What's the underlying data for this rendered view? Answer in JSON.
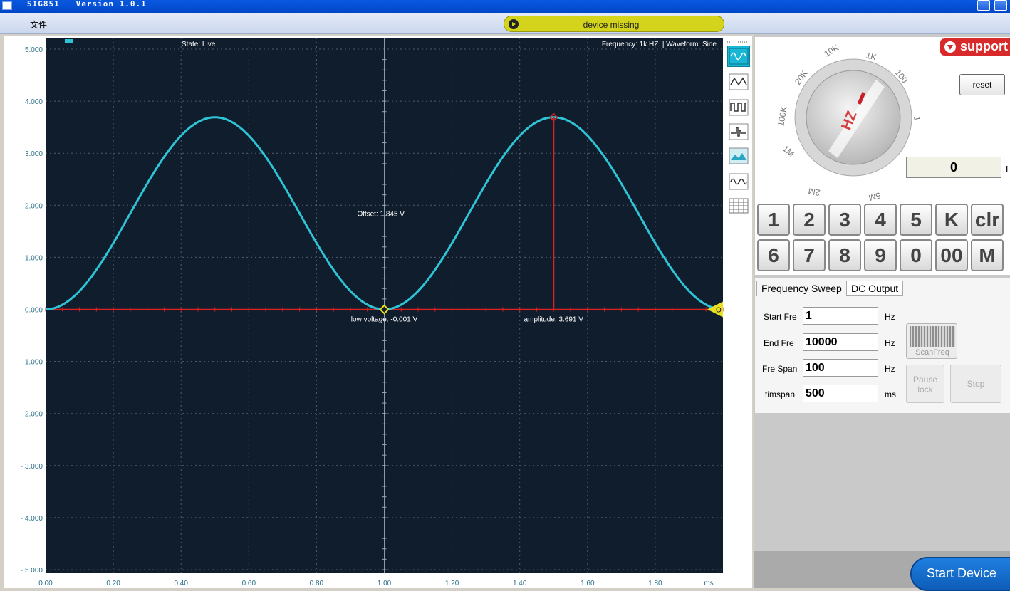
{
  "window": {
    "title": "SIG851   Version 1.0.1"
  },
  "menu": {
    "file": "文件"
  },
  "status": {
    "text": "device missing",
    "color": "#d4d41c"
  },
  "scope": {
    "state": "State: Live",
    "info": "Frequency: 1k HZ. | Waveform: Sine",
    "offset_label": "Offset: 1.845 V",
    "low_label": "low voltage: -0.001 V",
    "amp_label": "amplitude: 3.691 V",
    "trigger_marker": "O",
    "y_ticks": [
      "5.000",
      "4.000",
      "3.000",
      "2.000",
      "1.000",
      "0.000",
      "- 1.000",
      "- 2.000",
      "- 3.000",
      "- 4.000",
      "- 5.000"
    ],
    "x_ticks": [
      "0.00",
      "0.20",
      "0.40",
      "0.60",
      "0.80",
      "1.00",
      "1.20",
      "1.40",
      "1.60",
      "1.80"
    ],
    "x_unit": "ms",
    "colors": {
      "bg": "#101d2c",
      "trace": "#2ec4d6",
      "marker": "#e02020",
      "grid": "#7d8a99"
    }
  },
  "chart_data": {
    "type": "line",
    "title": "",
    "xlabel": "ms",
    "ylabel": "",
    "xlim": [
      0,
      2.0
    ],
    "ylim": [
      -5,
      5
    ],
    "series": [
      {
        "name": "",
        "function": "sine",
        "offset": 1.845,
        "amplitude": 1.845,
        "frequency_khz": 1,
        "x_start": 0,
        "x_end": 2.0
      }
    ],
    "annotations": [
      {
        "text": "Offset: 1.845 V"
      },
      {
        "text": "low voltage: -0.001 V",
        "x": 1.0,
        "y": -0.001
      },
      {
        "text": "amplitude: 3.691 V",
        "x": 1.5,
        "y": 3.691
      }
    ]
  },
  "tools": [
    "sine-wave-icon",
    "triangle-wave-icon",
    "square-wave-icon",
    "pulse-wave-icon",
    "image-wave-icon",
    "noise-wave-icon",
    "grid-table-icon"
  ],
  "dial": {
    "center_label": "HZ",
    "labels": [
      "10K",
      "1K",
      "100",
      "1",
      "20K",
      "100K",
      "1M",
      "2M",
      "5M"
    ]
  },
  "support": {
    "label": "support"
  },
  "reset": {
    "label": "reset"
  },
  "frequency": {
    "value": "0",
    "unit": "H"
  },
  "keypad": {
    "row1": [
      "1",
      "2",
      "3",
      "4",
      "5",
      "K",
      "clr"
    ],
    "row2": [
      "6",
      "7",
      "8",
      "9",
      "0",
      "00",
      "M"
    ]
  },
  "tabs": {
    "sweep": "Frequency Sweep",
    "dc": "DC Output"
  },
  "sweep": {
    "start_label": "Start Fre",
    "start_value": "1",
    "start_unit": "Hz",
    "end_label": "End Fre",
    "end_value": "10000",
    "end_unit": "Hz",
    "span_label": "Fre Span",
    "span_value": "100",
    "span_unit": "Hz",
    "time_label": "timspan",
    "time_value": "500",
    "time_unit": "ms",
    "scan_label": "ScanFreq",
    "pause_label_1": "Pause",
    "pause_label_2": "lock",
    "stop_label": "Stop"
  },
  "start_device": {
    "label": "Start Device"
  }
}
